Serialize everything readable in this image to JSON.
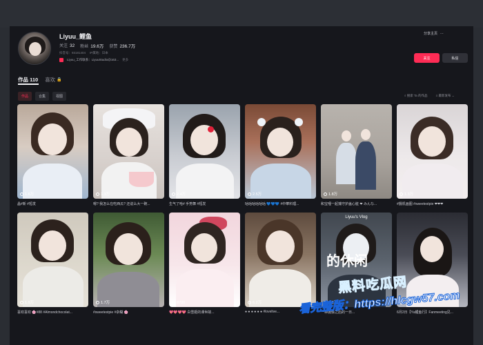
{
  "profile": {
    "username": "Liyuu_鲤鱼",
    "stats": [
      {
        "label": "关注",
        "value": "32"
      },
      {
        "label": "粉丝",
        "value": "19.6万"
      },
      {
        "label": "获赞",
        "value": "236.7万"
      }
    ],
    "meta": [
      "抖音号：93181404",
      "IP属地：日本"
    ],
    "bio": "Liyuu_工作联系：LiyuuStudio@163...",
    "bio_more": "更多",
    "share_label": "分享主页",
    "follow_label": "关注",
    "message_label": "私信"
  },
  "tabs": [
    {
      "label": "作品 110",
      "active": true
    },
    {
      "label": "喜欢",
      "active": false
    }
  ],
  "subtabs": [
    {
      "label": "作品",
      "active": true
    },
    {
      "label": "合集",
      "active": false
    },
    {
      "label": "视图",
      "active": false
    }
  ],
  "tools": {
    "search_label": "搜索 Ta 的作品",
    "sort_label": "最新发布"
  },
  "videos": [
    {
      "likes": "1.6万",
      "caption": "晶#新 #短发"
    },
    {
      "likes": "1.3万",
      "caption": "嗯? 我怎么在吃西瓜? 还说么大一碗..."
    },
    {
      "likes": "2.4万",
      "caption": "生气了哈# 手势舞 #短发"
    },
    {
      "likes": "2.5万",
      "caption": "咕咕咕咕咕咕 💙💙💙 #中華料理..."
    },
    {
      "likes": "1.8万",
      "caption": "和宝哩一起捕守护盖心脏 ❤ みんな..."
    },
    {
      "likes": "1.3万",
      "caption": "#摄机画图 #sweetestpie ❤❤❤"
    },
    {
      "likes": "1.9万",
      "caption": "喜欢喜欢 🌸#88 #Almondchocolat..."
    },
    {
      "likes": "1.7万",
      "caption": "#sweetestpie #杂糊 🌸"
    },
    {
      "likes": "8700",
      "caption": "💖💖💖💖 白雪姬的课世故..."
    },
    {
      "likes": "6.2万",
      "caption": "● ● ● ● ● ● #lovelive..."
    },
    {
      "likes": "1.3万",
      "caption": "一种摄像之后的一日..."
    },
    {
      "likes": "1.5万",
      "caption": "6月2日【Yu鲤鱼行】Fanmeeting见..."
    }
  ],
  "overlays": {
    "vlog_title": "Liyuu's Vlog",
    "vlog_big": "的休闲"
  },
  "watermark": {
    "brand": "黑料吃瓜网",
    "line": "看完整版：https://hlcgw57.com"
  },
  "colors": {
    "accent": "#fe2c55",
    "background": "#16171c"
  }
}
